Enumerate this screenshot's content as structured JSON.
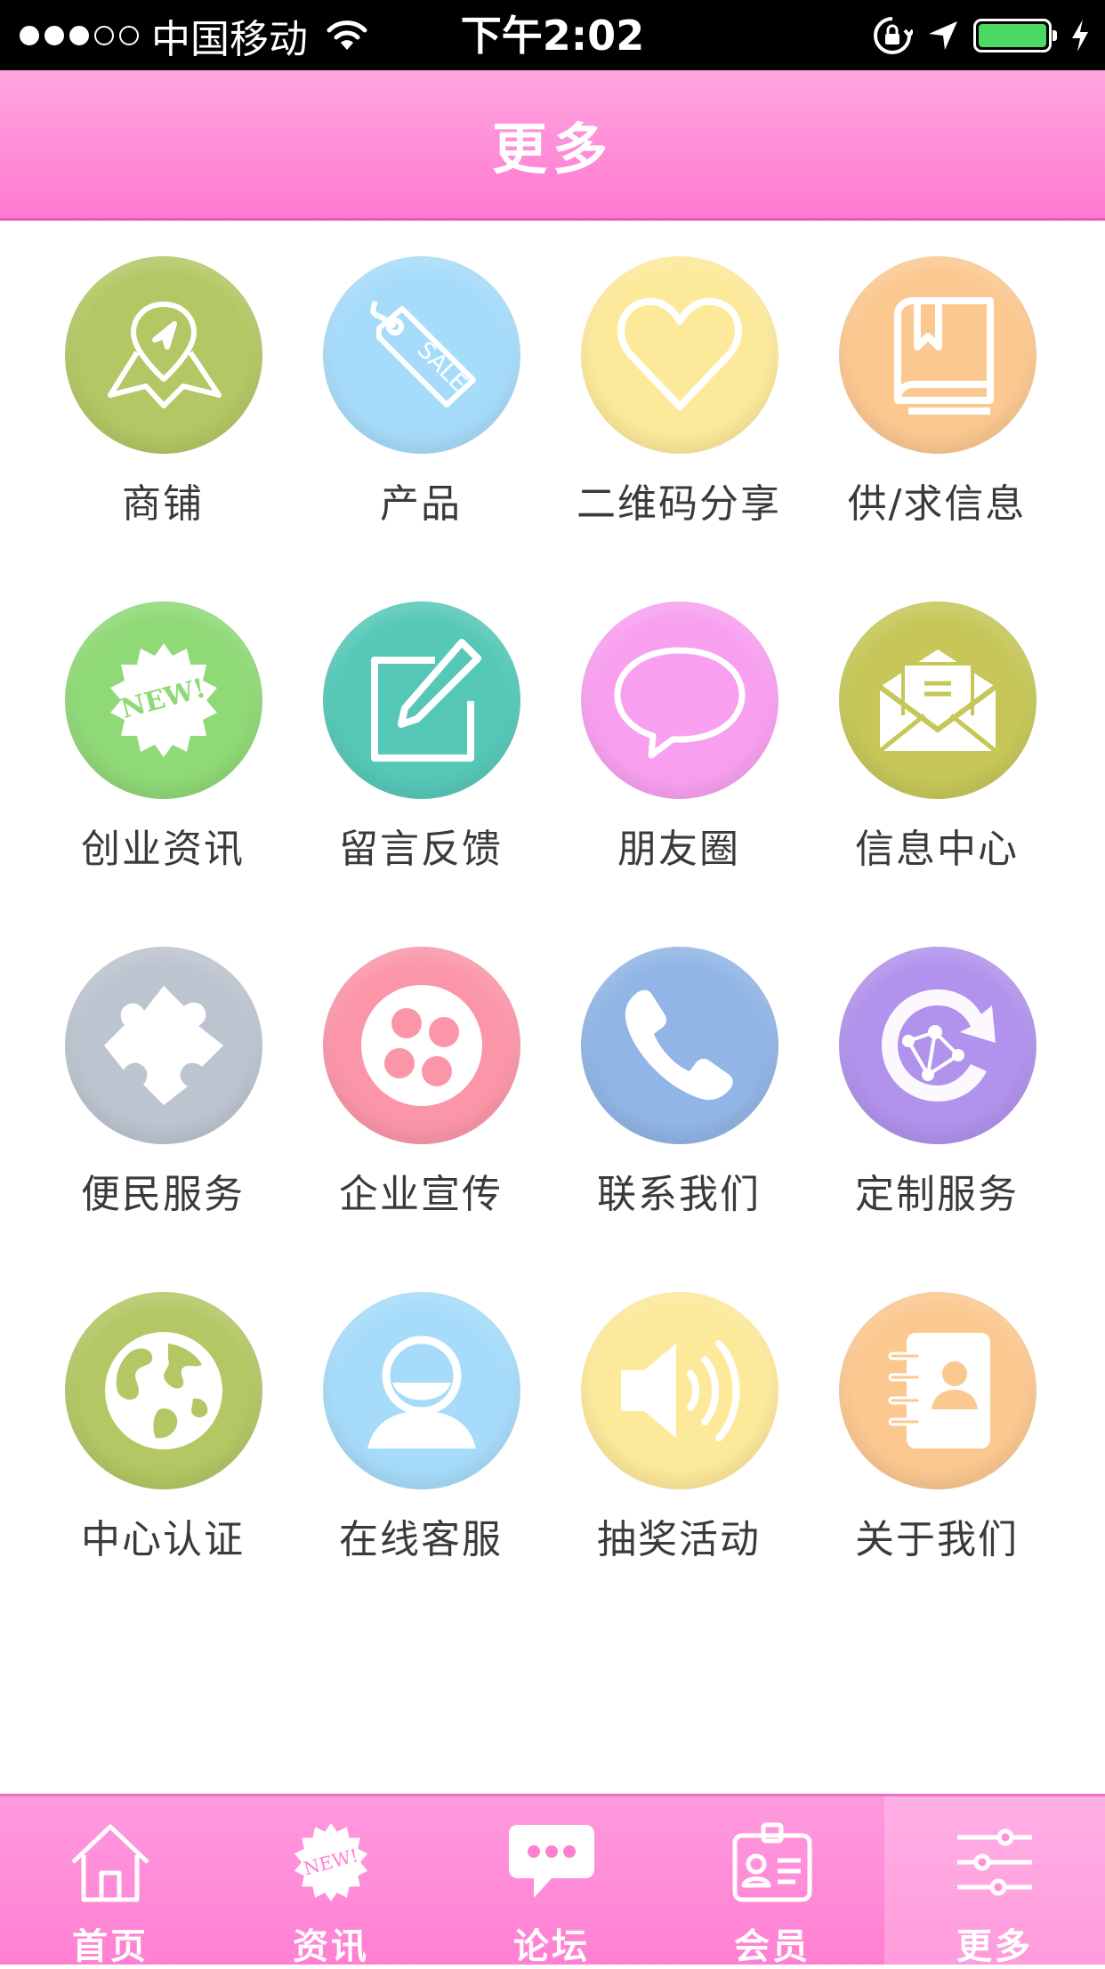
{
  "status_bar": {
    "signal_dots_filled": 3,
    "signal_dots_total": 5,
    "carrier": "中国移动",
    "time": "下午2:02",
    "battery_color": "#4cd964"
  },
  "header": {
    "title": "更多",
    "color": "#ff7fd2"
  },
  "grid": {
    "items": [
      {
        "label": "商铺",
        "icon": "map-pin-icon",
        "color": "#b3c764"
      },
      {
        "label": "产品",
        "icon": "sale-tag-icon",
        "color": "#a6dcfa"
      },
      {
        "label": "二维码分享",
        "icon": "heart-icon",
        "color": "#fde99a"
      },
      {
        "label": "供/求信息",
        "icon": "book-icon",
        "color": "#fbc890"
      },
      {
        "label": "创业资讯",
        "icon": "new-badge-icon",
        "color": "#8fd976"
      },
      {
        "label": "留言反馈",
        "icon": "edit-icon",
        "color": "#56c8b8"
      },
      {
        "label": "朋友圈",
        "icon": "chat-bubble-icon",
        "color": "#f8a0ef"
      },
      {
        "label": "信息中心",
        "icon": "mail-icon",
        "color": "#c6c758"
      },
      {
        "label": "便民服务",
        "icon": "puzzle-icon",
        "color": "#bcc4cf"
      },
      {
        "label": "企业宣传",
        "icon": "film-reel-icon",
        "color": "#fb96a8"
      },
      {
        "label": "联系我们",
        "icon": "phone-icon",
        "color": "#91b5e6"
      },
      {
        "label": "定制服务",
        "icon": "globe-network-icon",
        "color": "#b192ec"
      },
      {
        "label": "中心认证",
        "icon": "earth-icon",
        "color": "#b3c764"
      },
      {
        "label": "在线客服",
        "icon": "user-icon",
        "color": "#a6dcfa"
      },
      {
        "label": "抽奖活动",
        "icon": "speaker-icon",
        "color": "#fde99a"
      },
      {
        "label": "关于我们",
        "icon": "contact-book-icon",
        "color": "#fbc890"
      }
    ]
  },
  "tabbar": {
    "active_index": 4,
    "tabs": [
      {
        "label": "首页",
        "icon": "home-icon"
      },
      {
        "label": "资讯",
        "icon": "new-badge-icon"
      },
      {
        "label": "论坛",
        "icon": "chat-bubble-icon"
      },
      {
        "label": "会员",
        "icon": "member-card-icon"
      },
      {
        "label": "更多",
        "icon": "sliders-icon"
      }
    ]
  }
}
